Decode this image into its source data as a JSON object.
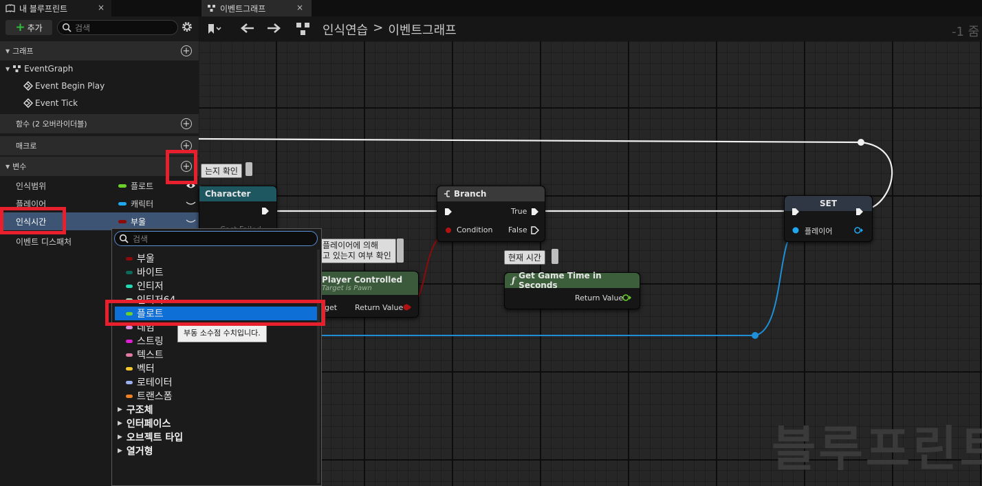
{
  "left_tab": {
    "title": "내 블루프린트",
    "close": "×"
  },
  "toolbar": {
    "add_label": "추가",
    "search_placeholder": "검색"
  },
  "sections": {
    "graphs": "그래프",
    "functions": "함수 (2 오버라이더블)",
    "macros": "매크로",
    "variables": "변수"
  },
  "graph_tree": {
    "event_graph": "EventGraph",
    "events": [
      "Event Begin Play",
      "Event Tick"
    ]
  },
  "variables": [
    {
      "name": "인식범위",
      "type": "플로트",
      "color": "#6bd12a"
    },
    {
      "name": "플레이어",
      "type": "캐릭터",
      "color": "#1fa8ef"
    },
    {
      "name": "인식시간",
      "type": "부울",
      "color": "#8e0b0b"
    }
  ],
  "event_dispatcher_label": "이벤트 디스패처",
  "graph_tab": {
    "title": "이벤트그래프",
    "close": "×"
  },
  "breadcrumb": {
    "root": "인식연습",
    "separator": ">",
    "current": "이벤트그래프"
  },
  "zoom_label": "-1 줌",
  "watermark": "블루프린트",
  "nodes": {
    "cast": {
      "title": "Character",
      "comment": "는지 확인",
      "partial_pin": "Cast Failed"
    },
    "pawn": {
      "title": "Player Controlled",
      "subtitle": "Target is Pawn",
      "pin_target": "Target",
      "pin_return": "Return Value",
      "comment_line1": "플레이어에 의해",
      "comment_line2": "고 있는지 여부 확인"
    },
    "branch": {
      "title": "Branch",
      "pin_true": "True",
      "pin_false": "False",
      "pin_condition": "Condition"
    },
    "gametime": {
      "title": "Get Game Time in Seconds",
      "pin_return": "Return Value",
      "comment": "현재 시간"
    },
    "set": {
      "title": "SET",
      "pin_player": "플레이어"
    }
  },
  "dropdown": {
    "search_placeholder": "검색",
    "types": [
      {
        "label": "부울",
        "color": "#8e0b0b"
      },
      {
        "label": "바이트",
        "color": "#0a6b5c"
      },
      {
        "label": "인티저",
        "color": "#21d9b5"
      },
      {
        "label": "인티저64",
        "color": "#a9e6c4"
      },
      {
        "label": "플로트",
        "color": "#6bd12a"
      },
      {
        "label": "네임",
        "color": "#d98ad9"
      },
      {
        "label": "스트링",
        "color": "#e01fd4"
      },
      {
        "label": "텍스트",
        "color": "#e27aa3"
      },
      {
        "label": "벡터",
        "color": "#f7c82b"
      },
      {
        "label": "로테이터",
        "color": "#9ab0f2"
      },
      {
        "label": "트랜스폼",
        "color": "#f08223"
      }
    ],
    "categories": [
      "구조체",
      "인터페이스",
      "오브젝트 타입",
      "열거형"
    ],
    "tooltip": "부동 소수점 수치입니다."
  }
}
